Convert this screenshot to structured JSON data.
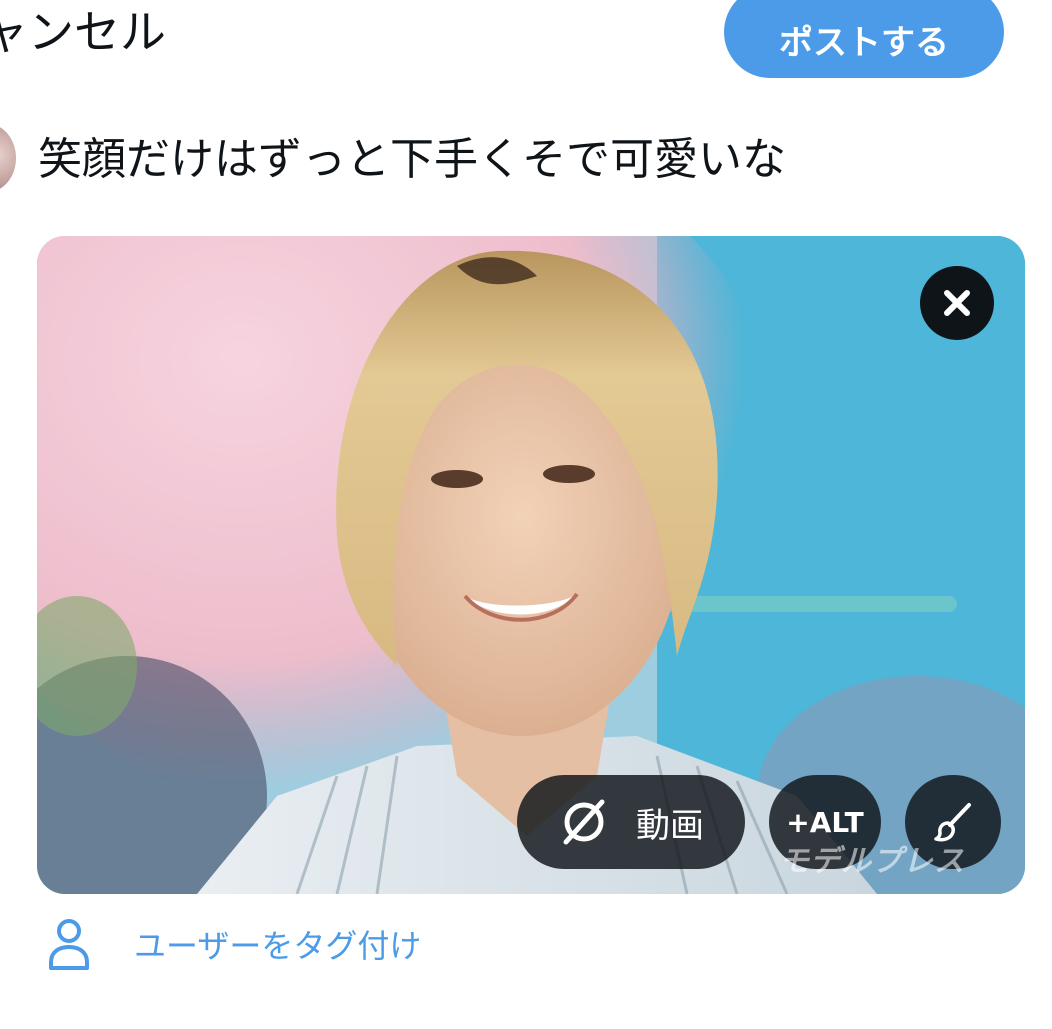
{
  "header": {
    "cancel_label": "ャンセル",
    "post_label": "ポストする"
  },
  "compose": {
    "text": "笑顔だけはずっと下手くそで可愛いな"
  },
  "media": {
    "video_label": "動画",
    "alt_label": "+ALT",
    "watermark": "モデルプレス"
  },
  "tag": {
    "label": "ユーザーをタグ付け"
  },
  "colors": {
    "accent": "#4c9be8",
    "text": "#0f1419",
    "overlay": "#0f1419"
  },
  "icons": {
    "close": "close-icon",
    "video": "gif-video-icon",
    "edit": "brush-icon",
    "tag": "person-icon"
  }
}
